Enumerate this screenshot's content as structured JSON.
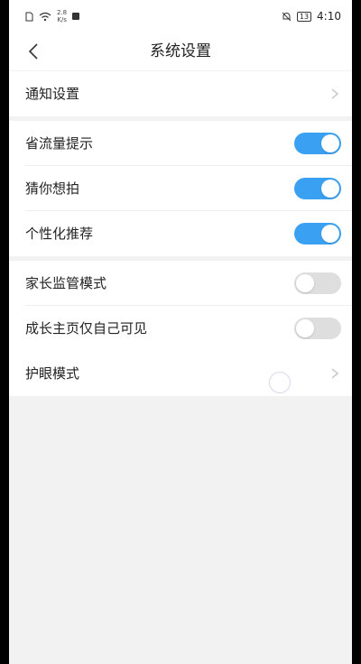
{
  "status_bar": {
    "net_speed_value": "2.8",
    "net_speed_unit": "K/s",
    "battery": "13",
    "time": "4:10"
  },
  "header": {
    "title": "系统设置"
  },
  "settings": {
    "notification": "通知设置",
    "data_saver": {
      "label": "省流量提示",
      "on": true
    },
    "guess_shoot": {
      "label": "猜你想拍",
      "on": true
    },
    "personalized": {
      "label": "个性化推荐",
      "on": true
    },
    "parental": {
      "label": "家长监管模式",
      "on": false
    },
    "growth_page": {
      "label": "成长主页仅自己可见",
      "on": false
    },
    "eye_care": "护眼模式"
  },
  "colors": {
    "accent": "#3aa1f2",
    "toggle_off": "#dedede"
  }
}
